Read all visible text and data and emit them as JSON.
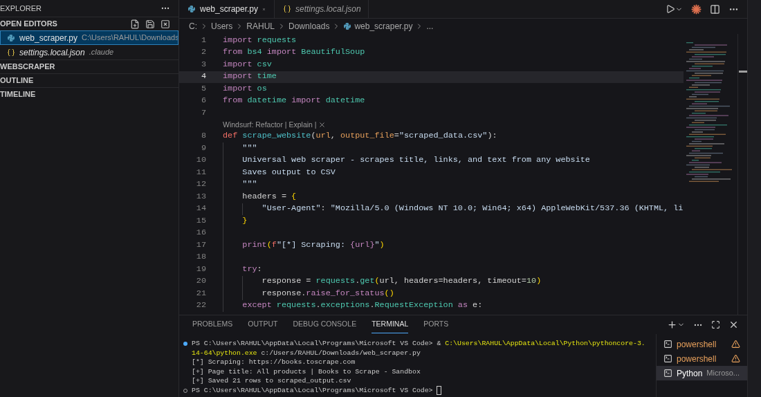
{
  "sidebar": {
    "title": "EXPLORER",
    "sections": [
      {
        "title": "OPEN EDITORS",
        "items": [
          {
            "name": "web_scraper.py",
            "detail": "C:\\Users\\RAHUL\\Downloads",
            "kind": "python",
            "selected": true,
            "preview": false
          },
          {
            "name": "settings.local.json",
            "detail": ".claude",
            "kind": "json",
            "selected": false,
            "preview": true
          }
        ]
      },
      {
        "title": "WEBSCRAPER"
      },
      {
        "title": "OUTLINE"
      },
      {
        "title": "TIMELINE"
      }
    ]
  },
  "tabs": [
    {
      "label": "web_scraper.py",
      "kind": "python",
      "selected": true,
      "preview": false
    },
    {
      "label": "settings.local.json",
      "kind": "json",
      "selected": false,
      "preview": true
    }
  ],
  "breadcrumb": [
    {
      "text": "C:",
      "kind": "folder"
    },
    {
      "text": "Users",
      "kind": "folder"
    },
    {
      "text": "RAHUL",
      "kind": "folder"
    },
    {
      "text": "Downloads",
      "kind": "folder"
    },
    {
      "text": "web_scraper.py",
      "kind": "python"
    },
    {
      "text": "...",
      "kind": "more"
    }
  ],
  "code": [
    {
      "num": "1",
      "current": false,
      "tokens": [
        {
          "text": "import ",
          "kind": "kw"
        },
        {
          "text": "requests",
          "kind": "mod"
        }
      ]
    },
    {
      "num": "2",
      "current": false,
      "tokens": [
        {
          "text": "from ",
          "kind": "kw"
        },
        {
          "text": "bs4 ",
          "kind": "mod"
        },
        {
          "text": "import ",
          "kind": "kw"
        },
        {
          "text": "BeautifulSoup",
          "kind": "mod"
        }
      ]
    },
    {
      "num": "3",
      "current": false,
      "tokens": [
        {
          "text": "import ",
          "kind": "kw"
        },
        {
          "text": "csv",
          "kind": "mod"
        }
      ]
    },
    {
      "num": "4",
      "current": true,
      "tokens": [
        {
          "text": "import ",
          "kind": "kw"
        },
        {
          "text": "time",
          "kind": "mod"
        }
      ]
    },
    {
      "num": "5",
      "current": false,
      "tokens": [
        {
          "text": "import ",
          "kind": "kw"
        },
        {
          "text": "os",
          "kind": "mod"
        }
      ]
    },
    {
      "num": "6",
      "current": false,
      "tokens": [
        {
          "text": "from ",
          "kind": "kw"
        },
        {
          "text": "datetime ",
          "kind": "mod"
        },
        {
          "text": "import ",
          "kind": "kw"
        },
        {
          "text": "datetime",
          "kind": "mod"
        }
      ]
    },
    {
      "num": "7",
      "current": false
    },
    {
      "num": "8",
      "current": false,
      "lens": "Windsurf: Refactor | Explain |",
      "tokens": [
        {
          "text": "def ",
          "kind": "def"
        },
        {
          "text": "scrape_website",
          "kind": "fn"
        },
        {
          "text": "(",
          "kind": "plain"
        },
        {
          "text": "url",
          "kind": "param"
        },
        {
          "text": ", ",
          "kind": "plain"
        },
        {
          "text": "output_file",
          "kind": "param"
        },
        {
          "text": "=",
          "kind": "plain"
        },
        {
          "text": "\"scraped_data.csv\"",
          "kind": "str"
        },
        {
          "text": "):",
          "kind": "plain"
        }
      ],
      "children": [
        {
          "num": "9",
          "current": false,
          "tokens": [
            {
              "text": "\"\"\"",
              "kind": "str"
            }
          ]
        },
        {
          "num": "10",
          "current": false,
          "tokens": [
            {
              "text": "Universal web scraper - scrapes title, links, and text from any website",
              "kind": "str"
            }
          ]
        },
        {
          "num": "11",
          "current": false,
          "tokens": [
            {
              "text": "Saves output to CSV",
              "kind": "str"
            }
          ]
        },
        {
          "num": "12",
          "current": false,
          "tokens": [
            {
              "text": "\"\"\"",
              "kind": "str"
            }
          ]
        },
        {
          "num": "13",
          "current": false,
          "tokens": [
            {
              "text": "headers ",
              "kind": "plain"
            },
            {
              "text": "= ",
              "kind": "plain"
            },
            {
              "text": "{",
              "kind": "brace"
            }
          ],
          "children": [
            {
              "num": "14",
              "current": false,
              "tokens": [
                {
                  "text": "\"User-Agent\"",
                  "kind": "str"
                },
                {
                  "text": ": ",
                  "kind": "plain"
                },
                {
                  "text": "\"Mozilla/5.0 (Windows NT 10.0; Win64; x64) AppleWebKit/537.36 (KHTML, li",
                  "kind": "str"
                }
              ]
            }
          ]
        },
        {
          "num": "15",
          "current": false,
          "tokens": [
            {
              "text": "}",
              "kind": "brace"
            }
          ]
        },
        {
          "num": "16",
          "current": false
        },
        {
          "num": "17",
          "current": false,
          "tokens": [
            {
              "text": "print",
              "kind": "kw"
            },
            {
              "text": "(",
              "kind": "brace"
            },
            {
              "text": "f",
              "kind": "def"
            },
            {
              "text": "\"[*] Scraping: ",
              "kind": "str"
            },
            {
              "text": "{url}",
              "kind": "kw"
            },
            {
              "text": "\"",
              "kind": "str"
            },
            {
              "text": ")",
              "kind": "brace"
            }
          ]
        },
        {
          "num": "18",
          "current": false
        },
        {
          "num": "19",
          "current": false,
          "tokens": [
            {
              "text": "try",
              "kind": "kw"
            },
            {
              "text": ":",
              "kind": "plain"
            }
          ],
          "children": [
            {
              "num": "20",
              "current": false,
              "tokens": [
                {
                  "text": "response ",
                  "kind": "plain"
                },
                {
                  "text": "= ",
                  "kind": "plain"
                },
                {
                  "text": "requests",
                  "kind": "mod"
                },
                {
                  "text": ".",
                  "kind": "plain"
                },
                {
                  "text": "get",
                  "kind": "mod"
                },
                {
                  "text": "(",
                  "kind": "brace"
                },
                {
                  "text": "url, headers=headers, timeout=",
                  "kind": "plain"
                },
                {
                  "text": "10",
                  "kind": "num"
                },
                {
                  "text": ")",
                  "kind": "brace"
                }
              ]
            },
            {
              "num": "21",
              "current": false,
              "tokens": [
                {
                  "text": "response.",
                  "kind": "plain"
                },
                {
                  "text": "raise_for_status",
                  "kind": "call"
                },
                {
                  "text": "()",
                  "kind": "brace"
                }
              ]
            }
          ]
        },
        {
          "num": "22",
          "current": false,
          "tokens": [
            {
              "text": "except ",
              "kind": "kw"
            },
            {
              "text": "requests",
              "kind": "mod"
            },
            {
              "text": ".",
              "kind": "plain"
            },
            {
              "text": "exceptions",
              "kind": "mod"
            },
            {
              "text": ".",
              "kind": "plain"
            },
            {
              "text": "RequestException ",
              "kind": "mod"
            },
            {
              "text": "as ",
              "kind": "kw"
            },
            {
              "text": "e:",
              "kind": "plain"
            }
          ]
        }
      ]
    }
  ],
  "panel_tabs": [
    {
      "label": "PROBLEMS",
      "selected": false
    },
    {
      "label": "OUTPUT",
      "selected": false
    },
    {
      "label": "DEBUG CONSOLE",
      "selected": false
    },
    {
      "label": "TERMINAL",
      "selected": true
    },
    {
      "label": "PORTS",
      "selected": false
    }
  ],
  "terminal": [
    {
      "kind": "success",
      "tokens": [
        {
          "text": "PS C:\\Users\\RAHUL\\AppData\\Local\\Programs\\Microsoft VS Code> & ",
          "kind": "plain"
        },
        {
          "text": "C:\\Users\\RAHUL\\AppData\\Local\\Python\\pythoncore-3.",
          "kind": "path"
        }
      ]
    },
    {
      "kind": "output",
      "tokens": [
        {
          "text": "14-64\\python.exe",
          "kind": "path"
        },
        {
          "text": " c:/Users/RAHUL/Downloads/web_scraper.py",
          "kind": "plain"
        }
      ]
    },
    {
      "kind": "output",
      "tokens": [
        {
          "text": "[*] Scraping: https://books.toscrape.com",
          "kind": "plain"
        }
      ]
    },
    {
      "kind": "output",
      "tokens": [
        {
          "text": "[+] Page title: All products | Books to Scrape - Sandbox",
          "kind": "plain"
        }
      ]
    },
    {
      "kind": "output",
      "tokens": [
        {
          "text": "[+] Saved 21 rows to scraped_output.csv",
          "kind": "plain"
        }
      ]
    },
    {
      "kind": "idle",
      "cursor": true,
      "tokens": [
        {
          "text": "PS C:\\Users\\RAHUL\\AppData\\Local\\Programs\\Microsoft VS Code> ",
          "kind": "plain"
        }
      ]
    }
  ],
  "terminals": [
    {
      "name": "powershell",
      "warning": true,
      "selected": false
    },
    {
      "name": "powershell",
      "warning": true,
      "selected": false
    },
    {
      "name": "Python",
      "detail": "Microso...",
      "warning": false,
      "selected": true
    }
  ]
}
